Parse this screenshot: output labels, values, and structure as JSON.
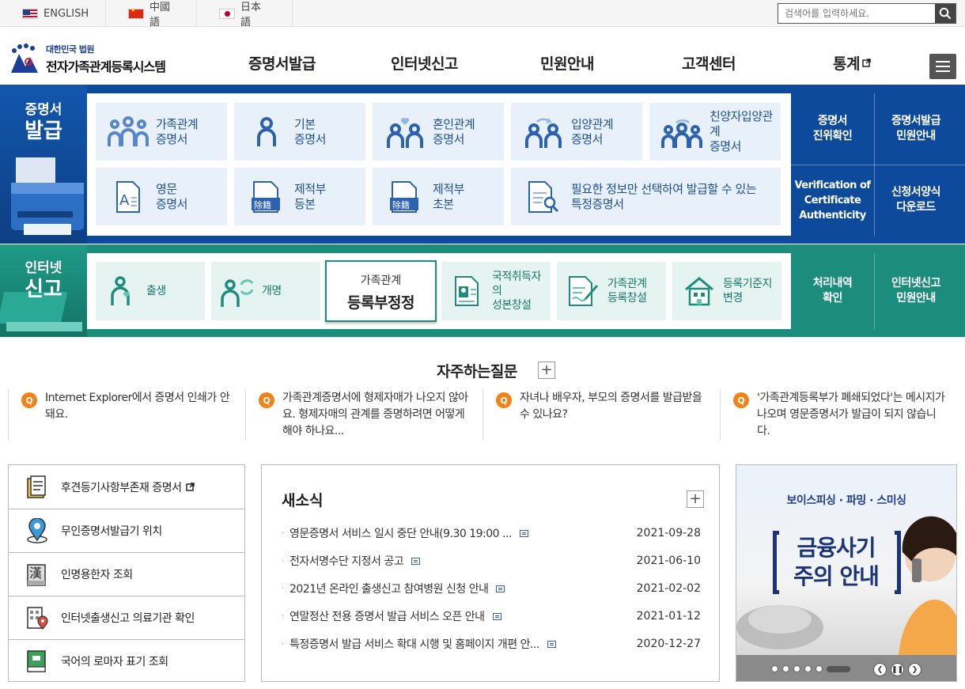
{
  "languages": [
    {
      "label": "ENGLISH"
    },
    {
      "label": "中國語"
    },
    {
      "label": "日本語"
    }
  ],
  "search": {
    "placeholder": "검색어를 입력하세요."
  },
  "logo": {
    "small": "대한민국 법원",
    "big": "전자가족관계등록시스템"
  },
  "nav": [
    "증명서발급",
    "인터넷신고",
    "민원안내",
    "고객센터",
    "통계"
  ],
  "cert_band": {
    "title_line1": "증명서",
    "title_line2": "발급",
    "tiles": [
      {
        "label": "가족관계\n증명서",
        "icon": "family-icon"
      },
      {
        "label": "기본\n증명서",
        "icon": "person-icon"
      },
      {
        "label": "혼인관계\n증명서",
        "icon": "couple-heart-icon"
      },
      {
        "label": "입양관계\n증명서",
        "icon": "adoption-icon"
      },
      {
        "label": "친양자입양관계\n증명서",
        "icon": "family-arrows-icon"
      },
      {
        "label": "영문\n증명서",
        "icon": "english-doc-icon"
      },
      {
        "label": "제적부\n등본",
        "icon": "removed-register-icon",
        "tag": "除籍"
      },
      {
        "label": "제적부\n초본",
        "icon": "removed-register-icon",
        "tag": "除籍"
      },
      {
        "label": "필요한 정보만 선택하여 발급할 수 있는\n특정증명서",
        "icon": "doc-search-icon"
      }
    ],
    "side": [
      {
        "label": "증명서\n진위확인"
      },
      {
        "label": "증명서발급\n민원안내"
      },
      {
        "label": "Verification of\nCertificate\nAuthenticity"
      },
      {
        "label": "신청서양식\n다운로드"
      }
    ]
  },
  "report_band": {
    "title_line1": "인터넷",
    "title_line2": "신고",
    "tiles": [
      {
        "label": "출생",
        "icon": "birth-icon"
      },
      {
        "label": "개명",
        "icon": "rename-icon"
      },
      {
        "label": "국적취득자의\n성본창설",
        "icon": "id-card-icon"
      },
      {
        "label": "가족관계\n등록창설",
        "icon": "doc-pen-icon"
      },
      {
        "label": "등록기준지\n변경",
        "icon": "house-icon"
      }
    ],
    "featured": {
      "small": "가족관계",
      "big": "등록부정정"
    },
    "side": [
      {
        "label": "처리내역\n확인"
      },
      {
        "label": "인터넷신고\n민원안내"
      }
    ]
  },
  "faq": {
    "title": "자주하는질문",
    "badge": "Q",
    "items": [
      {
        "text": "Internet Explorer에서 증명서 인쇄가 안돼요."
      },
      {
        "text": "가족관계증명서에 형제자매가 나오지 않아요. 형제자매의 관계를 증명하려면 어떻게 해야 하나요..."
      },
      {
        "text": "자녀나 배우자, 부모의 증명서를 발급받을 수 있나요?"
      },
      {
        "text": "'가족관계등록부가 폐쇄되었다'는 메시지가 나오며 영문증명서가 발급이 되지 않습니다."
      }
    ]
  },
  "quick_links": [
    {
      "label": "후견등기사항부존재 증명서",
      "icon": "doc-folder-icon",
      "external": true
    },
    {
      "label": "무인증명서발급기 위치",
      "icon": "location-pin-icon"
    },
    {
      "label": "인명용한자 조회",
      "icon": "hanja-book-icon",
      "glyph": "漢"
    },
    {
      "label": "인터넷출생신고 의료기관 확인",
      "icon": "hospital-pin-icon"
    },
    {
      "label": "국어의 로마자 표기 조회",
      "icon": "green-book-icon"
    }
  ],
  "news": {
    "title": "새소식",
    "items": [
      {
        "title": "영문증명서 서비스 일시 중단 안내(9.30 19:00 ...",
        "date": "2021-09-28"
      },
      {
        "title": "전자서명수단 지정서 공고",
        "date": "2021-06-10"
      },
      {
        "title": "2021년 온라인 출생신고 참여병원 신청 안내",
        "date": "2021-02-02"
      },
      {
        "title": "연말정산 전용 증명서 발급 서비스 오픈 안내",
        "date": "2021-01-12"
      },
      {
        "title": "특정증명서 발급 서비스 확대 시행 및 홈페이지 개편 안...",
        "date": "2020-12-27"
      }
    ]
  },
  "banner": {
    "top": "보이스피싱 · 파밍 · 스미싱",
    "main": "금융사기\n주의 안내",
    "slide_count": 6
  },
  "colors": {
    "cert_band": "#0e4a9b",
    "report_band": "#1c8c7c",
    "faq_badge": "#f08318",
    "cert_text": "#1d4f97",
    "report_text": "#17766a"
  }
}
